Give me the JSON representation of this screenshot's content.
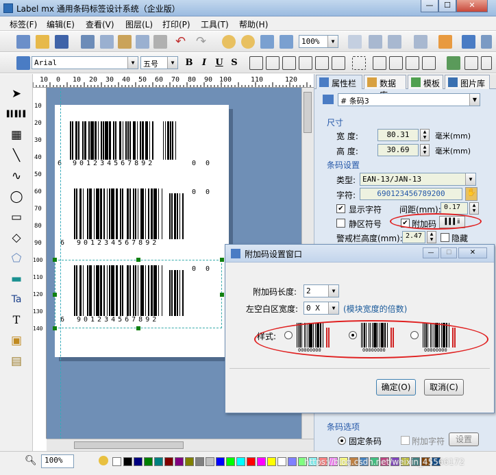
{
  "window": {
    "title": "Label mx 通用条码标签设计系统（企业版）",
    "min": "—",
    "max": "☐",
    "close": "✕"
  },
  "menu": [
    "标签(F)",
    "编辑(E)",
    "查看(V)",
    "图层(L)",
    "打印(P)",
    "工具(T)",
    "帮助(H)"
  ],
  "toolbar": {
    "zoom": "100%",
    "font": "Arial",
    "fontsize": "五号",
    "bold": "B",
    "italic": "I",
    "underline": "U",
    "strike": "S"
  },
  "ruler": {
    "h": [
      "10",
      "0",
      "10",
      "20",
      "30",
      "40",
      "50",
      "60",
      "70",
      "80",
      "90",
      "100",
      "110",
      "120"
    ],
    "v": [
      "10",
      "20",
      "30",
      "40",
      "50",
      "60",
      "70",
      "80",
      "90",
      "100",
      "110",
      "120",
      "130",
      "140"
    ]
  },
  "barcodes": [
    {
      "lead": "6",
      "digits": "901234567892",
      "addon": "0 0"
    },
    {
      "lead": "6",
      "digits": "901234567892",
      "addon": "0 0"
    },
    {
      "lead": "6",
      "digits": "901234567892",
      "addon": "0 0"
    }
  ],
  "panel": {
    "tabs": [
      "属性栏",
      "数据库",
      "模板",
      "图片库"
    ],
    "object": "# 条码3",
    "size_group": "尺寸",
    "width_label": "宽   度:",
    "width": "80.31",
    "width_unit": "毫米(mm)",
    "height_label": "高   度:",
    "height": "30.69",
    "height_unit": "毫米(mm)",
    "bc_group": "条码设置",
    "type_label": "类型:",
    "type": "EAN-13/JAN-13",
    "chars_label": "字符:",
    "chars": "690123456789200",
    "show_chars": "显示字符",
    "spacing_label": "间距(mm):",
    "spacing": "0.17",
    "quiet": "静区符号",
    "addon": "附加码",
    "guard_label": "警戒栏高度(mm):",
    "guard": "2.47",
    "hide": "隐藏",
    "options_group": "条码选项",
    "fixed": "固定条码",
    "addon_char": "附加字符",
    "setting": "设置"
  },
  "dialog": {
    "title": "附加码设置窗口",
    "len_label": "附加码长度:",
    "len": "2",
    "blank_label": "左空白区宽度:",
    "blank": "0 X",
    "blank_note": "(模块宽度的倍数)",
    "style_label": "样式:",
    "samples": [
      "00000000",
      "00000000",
      "00000000"
    ],
    "ok": "确定(O)",
    "cancel": "取消(C)"
  },
  "status": {
    "zoom": "100%",
    "watermark": "https://blog.csdn.net/weixin_45566172"
  },
  "colors": {
    "accent": "#2457a8",
    "oval": "#e02020",
    "canvas": "#6f8fb6"
  }
}
